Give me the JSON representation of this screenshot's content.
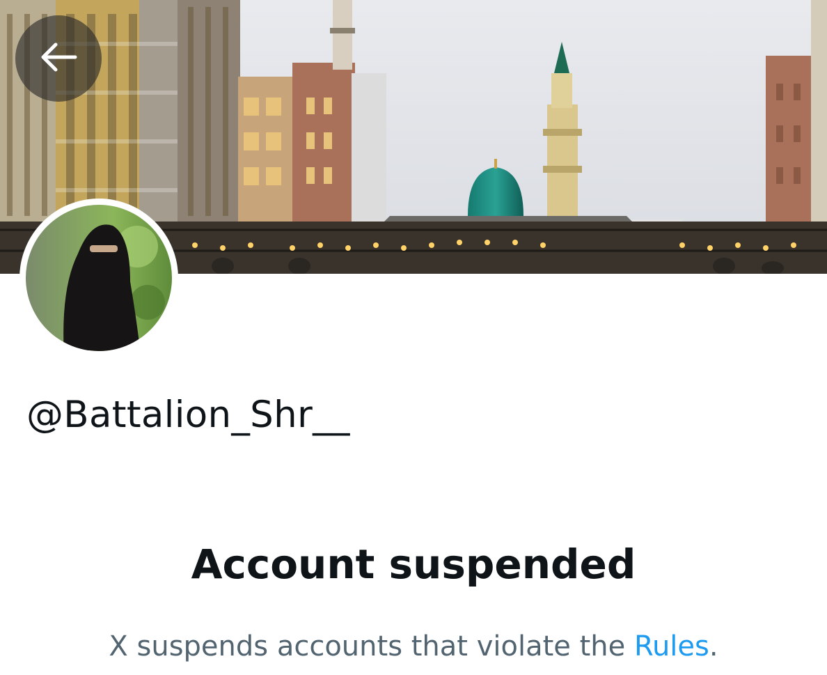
{
  "header": {
    "back_icon": "arrow-left-icon"
  },
  "profile": {
    "handle": "@Battalion_Shr__"
  },
  "suspension": {
    "title": "Account suspended",
    "message_prefix": "X suspends accounts that violate the ",
    "rules_link": "Rules",
    "message_suffix": "."
  },
  "colors": {
    "text_primary": "#0f1419",
    "text_secondary": "#536471",
    "link": "#1d9bf0"
  }
}
